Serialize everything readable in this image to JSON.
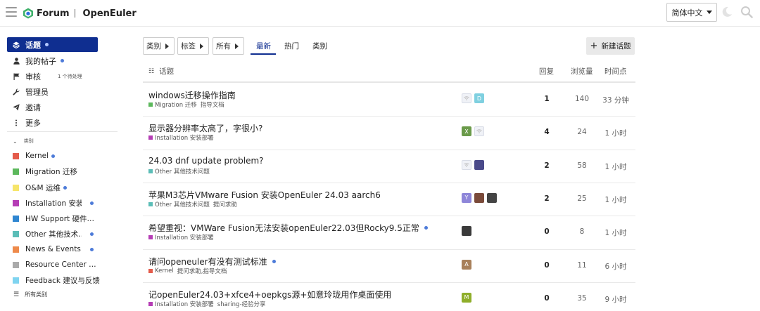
{
  "header": {
    "logo_forum": "Forum",
    "logo_brand": "OpenEuler",
    "lang_label": "简体中文"
  },
  "sidebar": {
    "nav": [
      {
        "label": "话题",
        "icon": "layers-icon",
        "dot": true,
        "active": true
      },
      {
        "label": "我的帖子",
        "icon": "user-icon",
        "dot": true
      },
      {
        "label": "审核",
        "icon": "flag-icon",
        "count": "1 个待处理"
      },
      {
        "label": "管理员",
        "icon": "wrench-icon"
      },
      {
        "label": "邀请",
        "icon": "send-icon"
      },
      {
        "label": "更多",
        "icon": "more-vertical-icon"
      }
    ],
    "categories_header": "类别",
    "categories": [
      {
        "label": "Kernel",
        "color": "#e45b4b",
        "dot": true
      },
      {
        "label": "Migration 迁移",
        "color": "#5cb85c"
      },
      {
        "label": "O&M 运维",
        "color": "#f6e56a",
        "dot": true
      },
      {
        "label": "Installation 安装…",
        "color": "#b53db5",
        "dot": true
      },
      {
        "label": "HW Support 硬件…",
        "color": "#2f86d1"
      },
      {
        "label": "Other 其他技术…",
        "color": "#5bbdb7",
        "dot": true
      },
      {
        "label": "News & Events …",
        "color": "#ee8a4b",
        "dot": true
      },
      {
        "label": "Resource Center …",
        "color": "#aaaaaa"
      },
      {
        "label": "Feedback 建议与反馈",
        "color": "#7fd4f0"
      }
    ],
    "all_categories": "所有类别"
  },
  "filters": {
    "category": "类别",
    "tags": "标签",
    "all": "所有"
  },
  "tabs": {
    "latest": "最新",
    "hot": "热门",
    "categories": "类别"
  },
  "new_topic": "新建话题",
  "columns": {
    "topic": "话题",
    "replies": "回复",
    "views": "浏览量",
    "activity": "时间点"
  },
  "topics": [
    {
      "title": "windows迁移操作指南",
      "category": "Migration 迁移",
      "cat_color": "#5cb85c",
      "tags": "指导文档",
      "replies": "1",
      "views": "140",
      "time": "33 分钟",
      "avatars": [
        {
          "type": "placeholder"
        },
        {
          "letter": "D",
          "color": "#7fd0e0"
        }
      ]
    },
    {
      "title": "显示器分辨率太高了，字很小?",
      "category": "Installation 安装部署",
      "cat_color": "#b53db5",
      "tags": "",
      "replies": "4",
      "views": "24",
      "time": "1 小时",
      "avatars": [
        {
          "letter": "X",
          "color": "#6a9a4a"
        },
        {
          "type": "placeholder"
        }
      ]
    },
    {
      "title": "24.03 dnf update problem?",
      "category": "Other 其他技术问题",
      "cat_color": "#5bbdb7",
      "tags": "",
      "replies": "2",
      "views": "58",
      "time": "1 小时",
      "avatars": [
        {
          "type": "placeholder"
        },
        {
          "type": "photo",
          "color": "#4a4a8a"
        }
      ]
    },
    {
      "title": "苹果M3芯片VMware Fusion 安装OpenEuler 24.03 aarch6",
      "category": "Other 其他技术问题",
      "cat_color": "#5bbdb7",
      "tags": "提问求助",
      "replies": "2",
      "views": "25",
      "time": "1 小时",
      "avatars": [
        {
          "letter": "Y",
          "color": "#8e86d9"
        },
        {
          "type": "photo",
          "color": "#7a4a3a"
        },
        {
          "type": "photo",
          "color": "#444444"
        }
      ]
    },
    {
      "title": "希望重视：VMWare Fusion无法安装openEuler22.03但Rocky9.5正常",
      "dot": true,
      "category": "Installation 安装部署",
      "cat_color": "#b53db5",
      "tags": "",
      "replies": "0",
      "views": "8",
      "time": "1 小时",
      "avatars": [
        {
          "type": "photo",
          "color": "#3a3a3a"
        }
      ]
    },
    {
      "title": "请问openeuler有没有测试标准",
      "dot": true,
      "category": "Kernel",
      "cat_color": "#e45b4b",
      "tags": "提问求助,指导文档",
      "replies": "0",
      "views": "11",
      "time": "6 小时",
      "avatars": [
        {
          "letter": "A",
          "color": "#a8805a"
        }
      ]
    },
    {
      "title": "记openEuler24.03+xfce4+oepkgs源+如意玲珑用作桌面使用",
      "category": "Installation 安装部署",
      "cat_color": "#b53db5",
      "tags": "sharing-经验分享",
      "replies": "0",
      "views": "35",
      "time": "9 小时",
      "avatars": [
        {
          "letter": "M",
          "color": "#8fae2a"
        }
      ]
    }
  ]
}
